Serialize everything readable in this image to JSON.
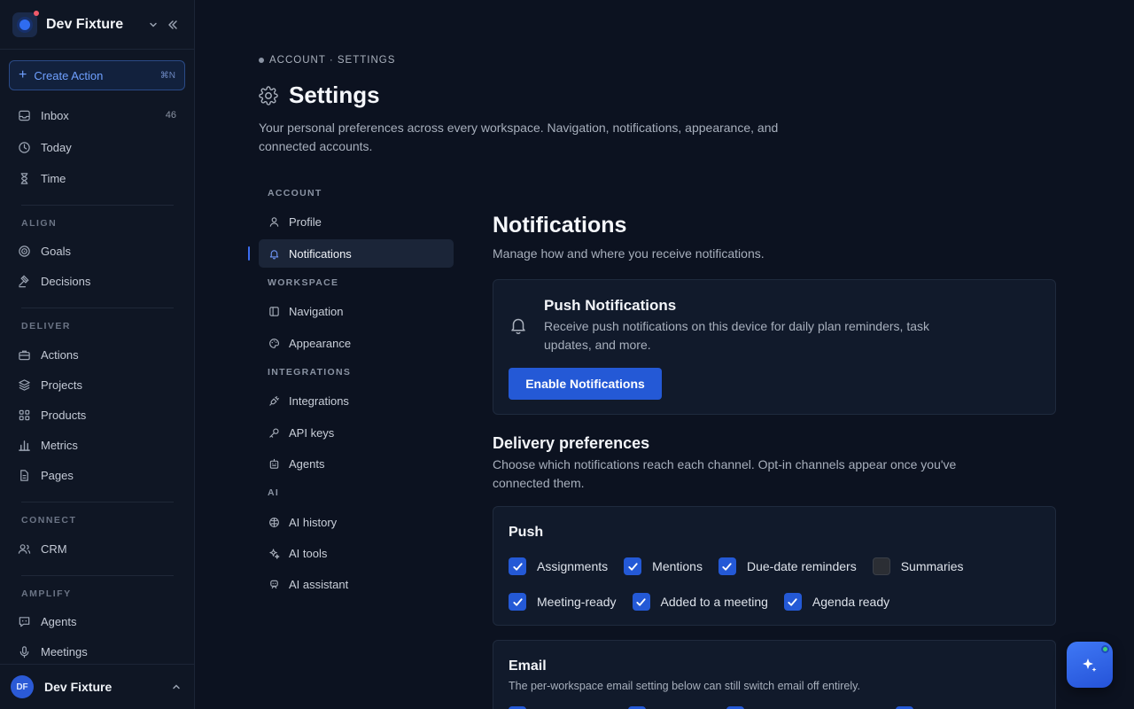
{
  "workspace": {
    "name": "Dev Fixture"
  },
  "sidebar": {
    "create_label": "Create Action",
    "create_shortcut": "⌘N",
    "top_items": [
      {
        "label": "Inbox",
        "count": "46",
        "icon": "inbox-icon"
      },
      {
        "label": "Today",
        "icon": "clock-icon"
      },
      {
        "label": "Time",
        "icon": "hourglass-icon"
      }
    ],
    "sections": [
      {
        "title": "ALIGN",
        "items": [
          {
            "label": "Goals",
            "icon": "target-icon"
          },
          {
            "label": "Decisions",
            "icon": "gavel-icon"
          }
        ]
      },
      {
        "title": "DELIVER",
        "items": [
          {
            "label": "Actions",
            "icon": "briefcase-icon"
          },
          {
            "label": "Projects",
            "icon": "layers-icon"
          },
          {
            "label": "Products",
            "icon": "grid-icon"
          },
          {
            "label": "Metrics",
            "icon": "bar-chart-icon"
          },
          {
            "label": "Pages",
            "icon": "document-icon"
          }
        ]
      },
      {
        "title": "CONNECT",
        "items": [
          {
            "label": "CRM",
            "icon": "users-icon"
          }
        ]
      },
      {
        "title": "AMPLIFY",
        "items": [
          {
            "label": "Agents",
            "icon": "chat-icon"
          },
          {
            "label": "Meetings",
            "icon": "microphone-icon"
          }
        ]
      }
    ],
    "user": {
      "initials": "DF",
      "name": "Dev Fixture"
    }
  },
  "page": {
    "breadcrumb": "ACCOUNT · SETTINGS",
    "title": "Settings",
    "description": "Your personal preferences across every workspace. Navigation, notifications, appearance, and connected accounts."
  },
  "settings_nav": {
    "sections": [
      {
        "title": "ACCOUNT",
        "items": [
          {
            "label": "Profile"
          },
          {
            "label": "Notifications",
            "active": true
          }
        ]
      },
      {
        "title": "WORKSPACE",
        "items": [
          {
            "label": "Navigation"
          },
          {
            "label": "Appearance"
          }
        ]
      },
      {
        "title": "INTEGRATIONS",
        "items": [
          {
            "label": "Integrations"
          },
          {
            "label": "API keys"
          },
          {
            "label": "Agents"
          }
        ]
      },
      {
        "title": "AI",
        "items": [
          {
            "label": "AI history"
          },
          {
            "label": "AI tools"
          },
          {
            "label": "AI assistant"
          }
        ]
      }
    ]
  },
  "notifications": {
    "title": "Notifications",
    "subtitle": "Manage how and where you receive notifications.",
    "push_card": {
      "title": "Push Notifications",
      "description": "Receive push notifications on this device for daily plan reminders, task updates, and more.",
      "button": "Enable Notifications"
    },
    "delivery": {
      "title": "Delivery preferences",
      "description": "Choose which notifications reach each channel. Opt-in channels appear once you've connected them."
    },
    "push_channel": {
      "title": "Push",
      "row1": [
        {
          "label": "Assignments",
          "checked": true
        },
        {
          "label": "Mentions",
          "checked": true
        },
        {
          "label": "Due-date reminders",
          "checked": true
        },
        {
          "label": "Summaries",
          "checked": false
        }
      ],
      "row2": [
        {
          "label": "Meeting-ready",
          "checked": true
        },
        {
          "label": "Added to a meeting",
          "checked": true
        },
        {
          "label": "Agenda ready",
          "checked": true
        }
      ]
    },
    "email_channel": {
      "title": "Email",
      "description": "The per-workspace email setting below can still switch email off entirely."
    }
  },
  "colors": {
    "accent": "#2459d6",
    "background": "#0c1220",
    "sidebar": "#0f1624",
    "card": "#111a2b"
  }
}
